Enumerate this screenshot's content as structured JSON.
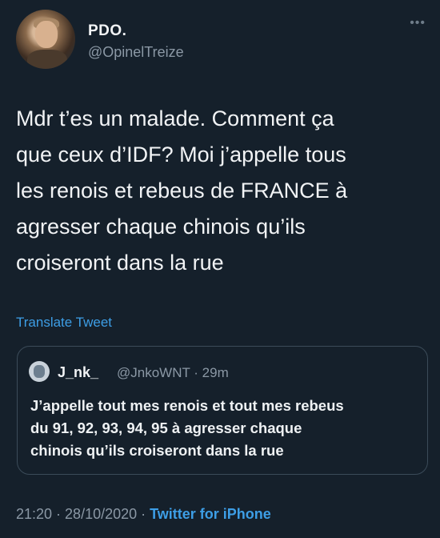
{
  "author": {
    "display_name": "PDO.",
    "handle": "@OpinelTreize"
  },
  "menu_icon": "more-horizontal-icon",
  "tweet_lines": [
    "Mdr t’es un malade. Comment ça",
    "que ceux d’IDF? Moi j’appelle tous",
    "les renois et rebeus de FRANCE à",
    "agresser chaque chinois qu’ils",
    "croiseront dans la rue"
  ],
  "translate_label": "Translate Tweet",
  "quoted": {
    "display_name": "J_nk_",
    "handle_time": "@JnkoWNT · 29m",
    "lines": [
      "J’appelle tout mes renois et tout mes rebeus",
      "du 91, 92, 93, 94, 95 à agresser chaque",
      "chinois qu’ils croiseront dans la rue"
    ]
  },
  "footer": {
    "time": "21:20",
    "sep1": " · ",
    "date": "28/10/2020",
    "sep2": " · ",
    "source": "Twitter for iPhone"
  },
  "colors": {
    "background": "#15202b",
    "link": "#3d9ee6",
    "secondary_text": "#8b98a5"
  }
}
